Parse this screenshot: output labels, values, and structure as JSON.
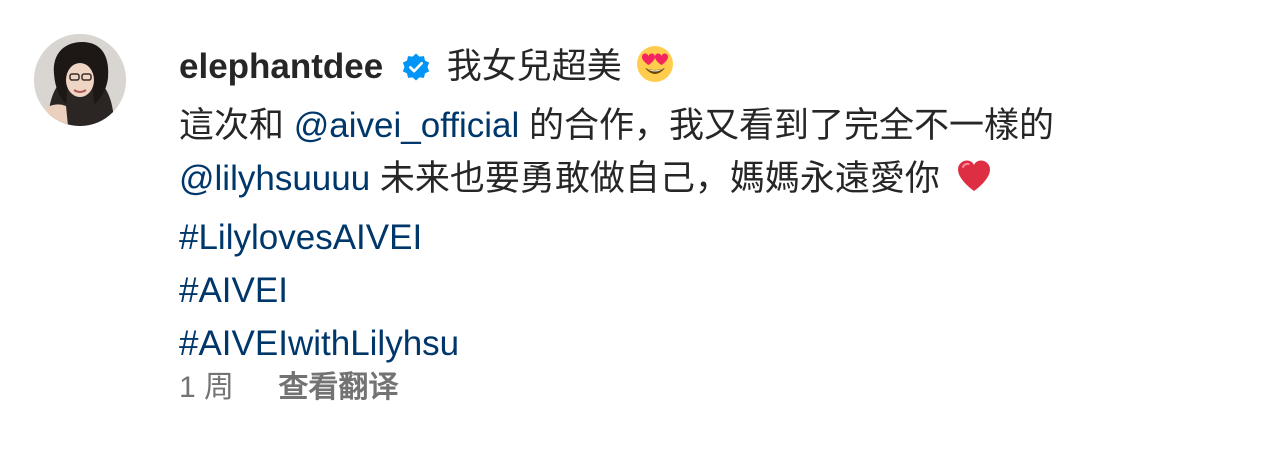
{
  "comment": {
    "username": "elephantdee",
    "intro_text": "我女兒超美",
    "body_line1_prefix": "這次和",
    "mention1": "@aivei_official",
    "body_line1_suffix": "的合作，我又看到了完全不一樣的",
    "mention2": "@lilyhsuuuu",
    "body_line2_suffix": "未来也要勇敢做自己，媽媽永遠愛你",
    "hashtags": [
      "#LilylovesAIVEI",
      "#AIVEI",
      "#AIVEIwithLilyhsu"
    ]
  },
  "meta": {
    "time": "1 周",
    "translate_label": "查看翻译"
  },
  "icons": {
    "verified": "verified-badge-icon",
    "heart_eyes": "heart-eyes-emoji",
    "heart": "red-heart-emoji"
  },
  "colors": {
    "link": "#00376b",
    "verified": "#0095f6",
    "meta": "#737373",
    "text": "#262626"
  }
}
